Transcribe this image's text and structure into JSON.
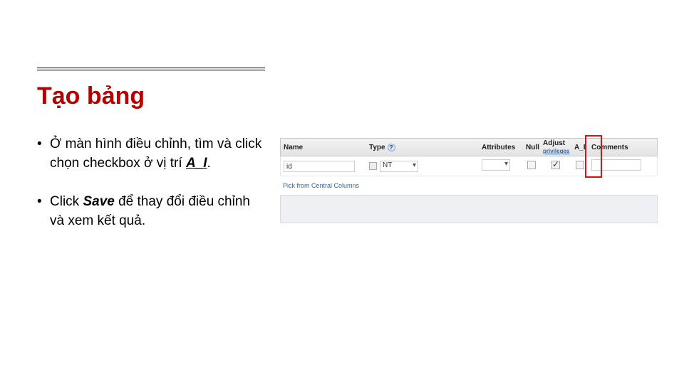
{
  "title": "Tạo bảng",
  "bullets": {
    "b1_pre": "Ở màn hình điều chỉnh, tìm và click chọn checkbox ở vị trí ",
    "b1_em": "A_I",
    "b1_post": ".",
    "b2_pre": "Click ",
    "b2_em": "Save",
    "b2_post": " để thay đổi điều chỉnh và xem kết quả."
  },
  "headers": {
    "name": "Name",
    "type": "Type",
    "attributes": "Attributes",
    "null": "Null",
    "adjust": "Adjust",
    "privileges": "privileges",
    "ai": "A_I",
    "comments": "Comments"
  },
  "row": {
    "name_value": "id",
    "type_value": "NT"
  },
  "under_link": "Pick from Central Columns",
  "help_glyph": "?"
}
